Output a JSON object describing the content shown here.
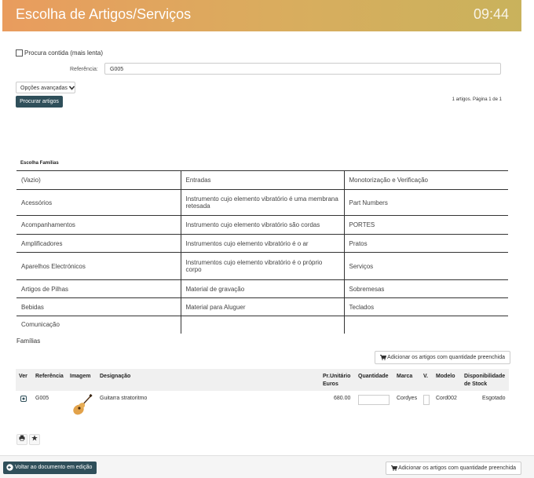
{
  "header": {
    "title": "Escolha de Artigos/Serviços",
    "clock": "09:44"
  },
  "search": {
    "contained_label": "Procura contida (mais lenta)",
    "reference_label": "Referência:",
    "reference_value": "G005",
    "advanced_label": "Opções avançadas",
    "search_button": "Procurar artigos",
    "pager": "1 artigos. Página 1 de 1"
  },
  "families": {
    "title": "Escolha Famílias",
    "rows": [
      [
        "(Vazio)",
        "Entradas",
        "Monotorização e Verificação"
      ],
      [
        "Acessórios",
        "Instrumento cujo elemento vibratório é uma membrana retesada",
        "Part Numbers"
      ],
      [
        "Acompanhamentos",
        "Instrumento cujo elemento vibratório são cordas",
        "PORTES"
      ],
      [
        "Amplificadores",
        "Instrumentos cujo elemento vibratório é o ar",
        "Pratos"
      ],
      [
        "Aparelhos Electrónicos",
        "Instrumentos cujo elemento vibratório é o próprio corpo",
        "Serviços"
      ],
      [
        "Artigos de Pilhas",
        "Material de gravação",
        "Sobremesas"
      ],
      [
        "Bebidas",
        "Material para Aluguer",
        "Teclados"
      ],
      [
        "Comunicação",
        "",
        ""
      ]
    ],
    "section_label": "Famílias"
  },
  "articles": {
    "add_button": "Adicionar os artigos com quantidade preenchida",
    "columns": {
      "ver": "Ver",
      "ref": "Referência",
      "img": "Imagem",
      "desc": "Designação",
      "price": "Pr.Unitário Euros",
      "qty": "Quantidade",
      "brand": "Marca",
      "v": "V.",
      "model": "Modelo",
      "stock": "Disponibilidade de Stock"
    },
    "rows": [
      {
        "ref": "G005",
        "desc": "Guitarra stratoritmo",
        "price": "680.00",
        "brand": "Cordyes",
        "model": "Cord002",
        "stock": "Esgotado"
      }
    ]
  },
  "footer": {
    "back_button": "Voltar ao documento em edição",
    "add_button": "Adicionar os artigos com quantidade preenchida"
  }
}
